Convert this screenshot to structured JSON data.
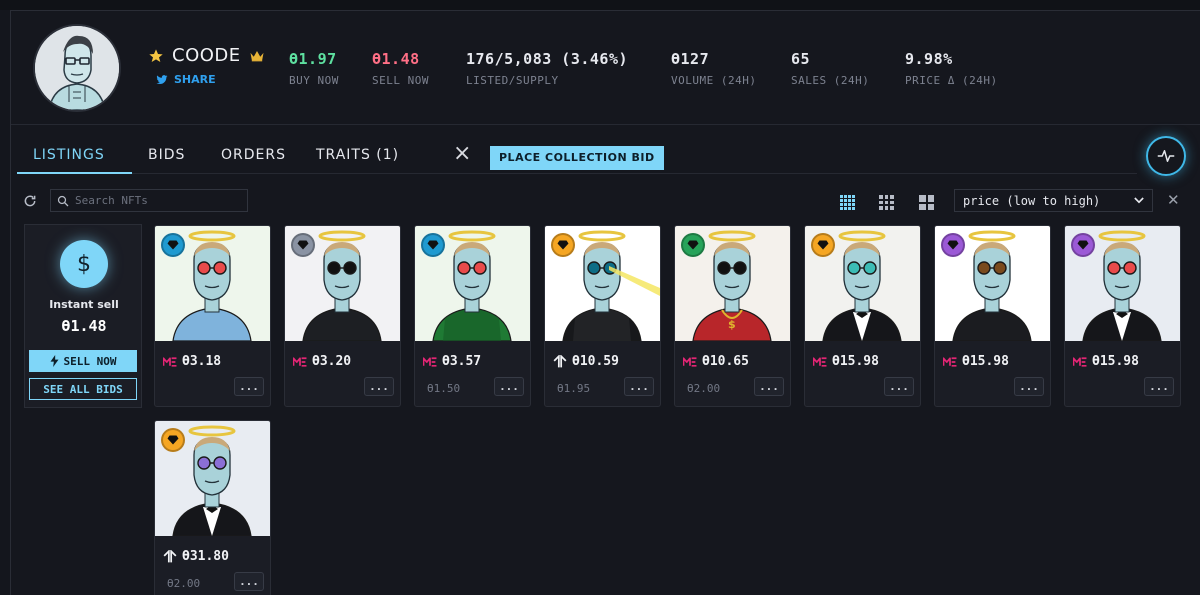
{
  "collection": {
    "name": "COODE",
    "share_label": "SHARE"
  },
  "stats": [
    {
      "value": "Ө1.97",
      "label": "BUY NOW",
      "color": "#5ee0a0"
    },
    {
      "value": "Ө1.48",
      "label": "SELL NOW",
      "color": "#ff6f86"
    },
    {
      "value": "176/5,083 (3.46%)",
      "label": "LISTED/SUPPLY",
      "color": "#f1f2f5"
    },
    {
      "value": "Ө127",
      "label": "VOLUME (24H)",
      "color": "#f1f2f5"
    },
    {
      "value": "65",
      "label": "SALES (24H)",
      "color": "#f1f2f5"
    },
    {
      "value": "9.98%",
      "label": "PRICE Δ (24H)",
      "color": "#f1f2f5"
    }
  ],
  "tabs": {
    "listings": "LISTINGS",
    "bids": "BIDS",
    "orders": "ORDERS",
    "traits": "TRAITS (1)",
    "place_bid": "PLACE COLLECTION BID"
  },
  "toolbar": {
    "search_placeholder": "Search NFTs",
    "sort_value": "price (low to high)"
  },
  "instant_sell": {
    "symbol": "$",
    "label": "Instant sell",
    "amount": "Ө1.48",
    "sell_now": "SELL NOW",
    "see_all_bids": "SEE ALL BIDS"
  },
  "cards": [
    {
      "price": "Ө3.18",
      "last": "",
      "market": "magic-eden-icon",
      "rank_color": "#1f9ad0",
      "bg": "#eef6ec",
      "outfit": "denim",
      "eyes": "red"
    },
    {
      "price": "Ө3.20",
      "last": "",
      "market": "magic-eden-icon",
      "rank_color": "#8a93a3",
      "bg": "#f2f2f4",
      "outfit": "puffer",
      "eyes": "dark"
    },
    {
      "price": "Ө3.57",
      "last": "Ө1.50",
      "market": "magic-eden-icon",
      "rank_color": "#1f9ad0",
      "bg": "#eef6ec",
      "outfit": "hoodie-green",
      "eyes": "red"
    },
    {
      "price": "Ө10.59",
      "last": "Ө1.95",
      "market": "tensor-icon",
      "rank_color": "#f5a623",
      "bg": "#ffffff",
      "outfit": "hoodie-black",
      "eyes": "laser"
    },
    {
      "price": "Ө10.65",
      "last": "Ө2.00",
      "market": "magic-eden-icon",
      "rank_color": "#27a35a",
      "bg": "#f4f1ec",
      "outfit": "red-jacket",
      "eyes": "dark"
    },
    {
      "price": "Ө15.98",
      "last": "",
      "market": "magic-eden-icon",
      "rank_color": "#f5a623",
      "bg": "#f2f2ef",
      "outfit": "tux",
      "eyes": "teal"
    },
    {
      "price": "Ө15.98",
      "last": "",
      "market": "magic-eden-icon",
      "rank_color": "#9b59d6",
      "bg": "#ffffff",
      "outfit": "suit",
      "eyes": "brown"
    },
    {
      "price": "Ө15.98",
      "last": "",
      "market": "magic-eden-icon",
      "rank_color": "#9b59d6",
      "bg": "#e8ecf2",
      "outfit": "tux",
      "eyes": "red"
    },
    {
      "price": "Ө31.80",
      "last": "Ө2.00",
      "market": "tensor-icon",
      "rank_color": "#f5a623",
      "bg": "#e8ecf2",
      "outfit": "tux",
      "eyes": "purple"
    }
  ],
  "colors": {
    "accent": "#7fd6f8",
    "buy": "#5ee0a0",
    "sell": "#ff6f86",
    "magic_eden": "#e42575"
  }
}
